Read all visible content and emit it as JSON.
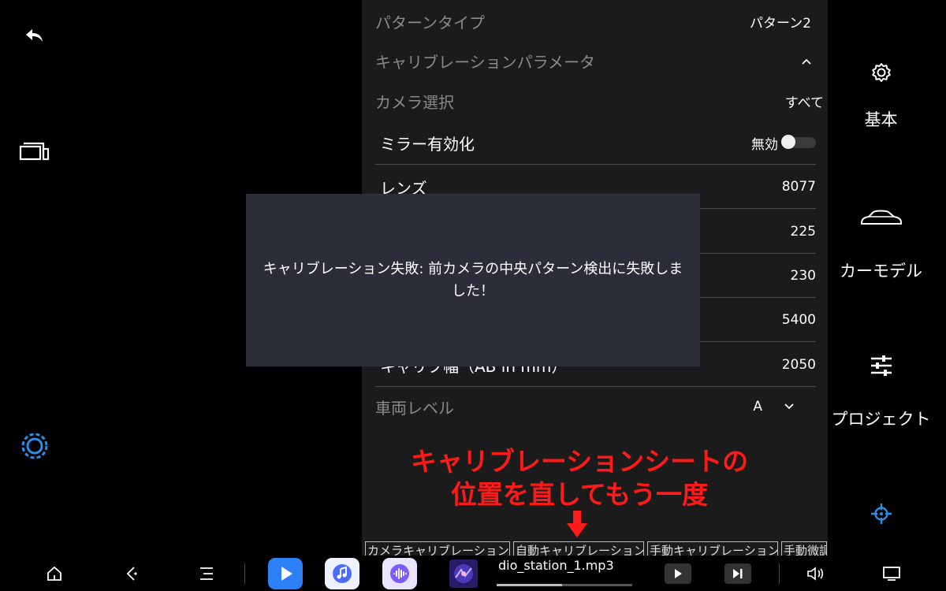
{
  "settings": {
    "pattern_type": {
      "label": "パターンタイプ",
      "value": "パターン2"
    },
    "calib_params": {
      "label": "キャリブレーションパラメータ"
    },
    "camera_select": {
      "label": "カメラ選択",
      "value": "すべて"
    },
    "mirror": {
      "label": "ミラー有効化",
      "value": "無効",
      "enabled": false
    },
    "lens": {
      "label": "レンズ",
      "value": "8077"
    },
    "rows": [
      {
        "value": "225"
      },
      {
        "value": "230"
      },
      {
        "value": "5400"
      },
      {
        "label": "キャリブ幅（AB in mm）",
        "value": "2050"
      }
    ],
    "vehicle_level": {
      "label": "車両レベル",
      "value": "A"
    }
  },
  "right_tabs": {
    "basic": "基本",
    "car_model": "カーモデル",
    "project": "プロジェクト"
  },
  "buttons": {
    "camera_calib": "カメラキャリブレーション",
    "auto_calib": "自動キャリブレーション",
    "manual_calib": "手動キャリブレーション",
    "manual_fine": "手動微調整"
  },
  "modal": {
    "message": "キャリブレーション失敗: 前カメラの中央パターン検出に失敗しました！"
  },
  "annotation": {
    "line1": "キャリブレーションシートの",
    "line2": "位置を直してもう一度"
  },
  "media": {
    "track": "dio_station_1.mp3",
    "progress": 0.48
  },
  "colors": {
    "accent_blue": "#2a8fe6",
    "annotation_red": "#ff1a1a",
    "modal_bg": "#2b2e38"
  }
}
